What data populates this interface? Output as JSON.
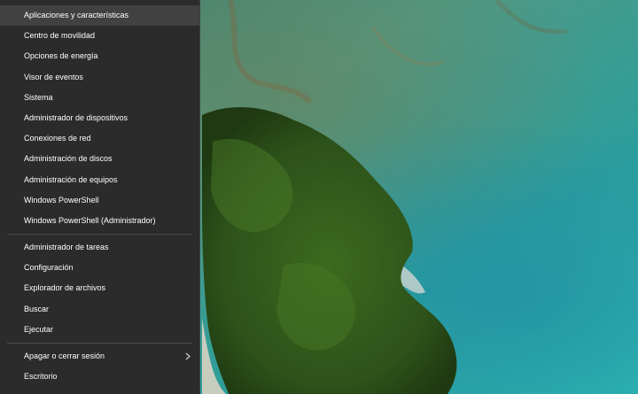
{
  "menu": {
    "group1": [
      {
        "label": "Aplicaciones y características",
        "key": "apps"
      },
      {
        "label": "Centro de movilidad",
        "key": "mobility"
      },
      {
        "label": "Opciones de energía",
        "key": "power-options"
      },
      {
        "label": "Visor de eventos",
        "key": "event-viewer"
      },
      {
        "label": "Sistema",
        "key": "system"
      },
      {
        "label": "Administrador de dispositivos",
        "key": "device-manager"
      },
      {
        "label": "Conexiones de red",
        "key": "network-connections"
      },
      {
        "label": "Administración de discos",
        "key": "disk-management"
      },
      {
        "label": "Administración de equipos",
        "key": "computer-management"
      },
      {
        "label": "Windows PowerShell",
        "key": "powershell"
      },
      {
        "label": "Windows PowerShell (Administrador)",
        "key": "powershell-admin"
      }
    ],
    "group2": [
      {
        "label": "Administrador de tareas",
        "key": "task-manager"
      },
      {
        "label": "Configuración",
        "key": "settings"
      },
      {
        "label": "Explorador de archivos",
        "key": "file-explorer"
      },
      {
        "label": "Buscar",
        "key": "search"
      },
      {
        "label": "Ejecutar",
        "key": "run"
      }
    ],
    "group3": [
      {
        "label": "Apagar o cerrar sesión",
        "key": "shutdown-signout",
        "submenu_icon": "chevron-right-icon"
      },
      {
        "label": "Escritorio",
        "key": "desktop"
      }
    ],
    "hovered_item": "apps"
  },
  "colors": {
    "menu_bg": "#2b2b2b",
    "hover_bg": "#414141",
    "separator": "#4a4a4a",
    "text": "#ffffff"
  }
}
